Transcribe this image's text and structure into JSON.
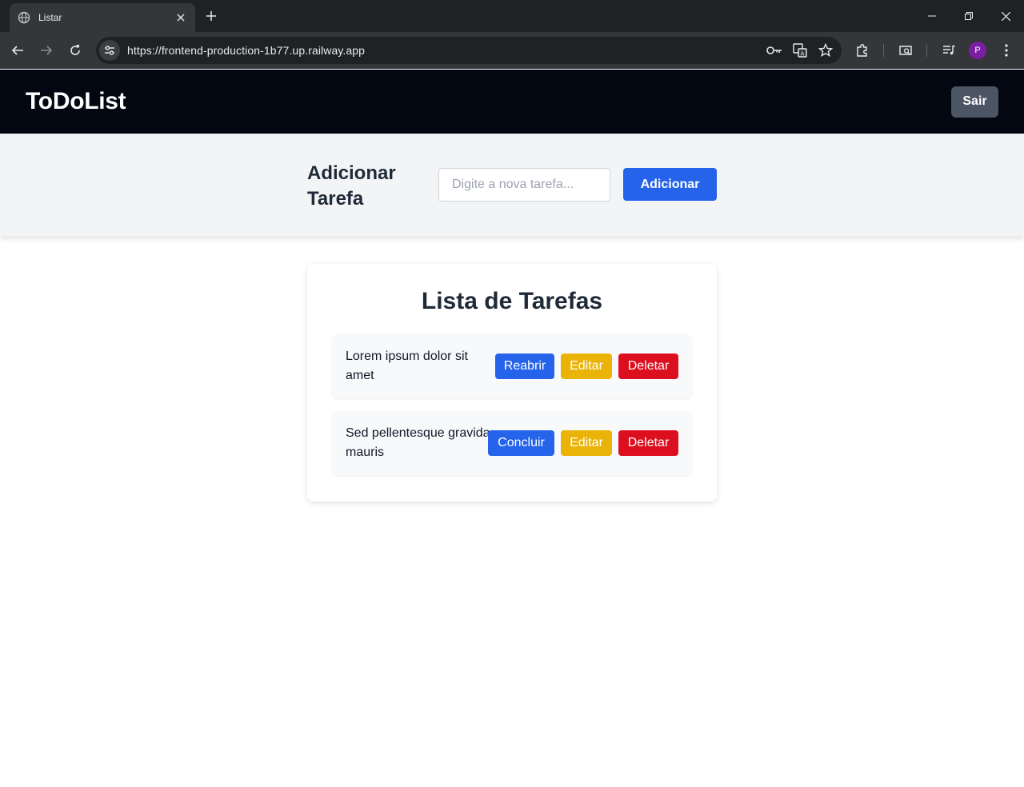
{
  "browser": {
    "tab_title": "Listar",
    "url": "https://frontend-production-1b77.up.railway.app",
    "profile_initial": "P"
  },
  "header": {
    "brand": "ToDoList",
    "logout_label": "Sair"
  },
  "add_task": {
    "title": "Adicionar Tarefa",
    "placeholder": "Digite a nova tarefa...",
    "value": "",
    "button_label": "Adicionar"
  },
  "task_list": {
    "title": "Lista de Tarefas",
    "items": [
      {
        "text": "Lorem ipsum dolor sit amet",
        "status_button": "Reabrir",
        "edit_button": "Editar",
        "delete_button": "Deletar"
      },
      {
        "text": "Sed pellentesque gravida mauris",
        "status_button": "Concluir",
        "edit_button": "Editar",
        "delete_button": "Deletar"
      }
    ]
  },
  "colors": {
    "header_bg": "#030712",
    "primary": "#2563eb",
    "warning": "#eab308",
    "danger": "#dc0f1f",
    "logout_bg": "#4b5563"
  }
}
